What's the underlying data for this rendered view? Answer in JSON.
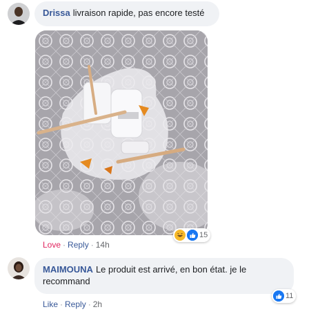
{
  "comments": [
    {
      "author": "Drissa",
      "text": "livraison rapide, pas encore testé",
      "actions": {
        "love": "Love",
        "reply": "Reply",
        "time": "14h"
      },
      "reactions": {
        "count": "15",
        "icons": [
          "haha-icon",
          "like-icon"
        ]
      }
    },
    {
      "author": "MAIMOUNA",
      "text_line1": "Le produit est arrivé, en bon état. je le",
      "text_line2": "recommand",
      "actions": {
        "like": "Like",
        "reply": "Reply",
        "time": "2h"
      },
      "reactions": {
        "count": "11",
        "icons": [
          "like-icon"
        ]
      }
    }
  ],
  "colors": {
    "link": "#385898",
    "bubble": "#f0f2f5",
    "love": "#e0245e",
    "like": "#1877f2"
  }
}
